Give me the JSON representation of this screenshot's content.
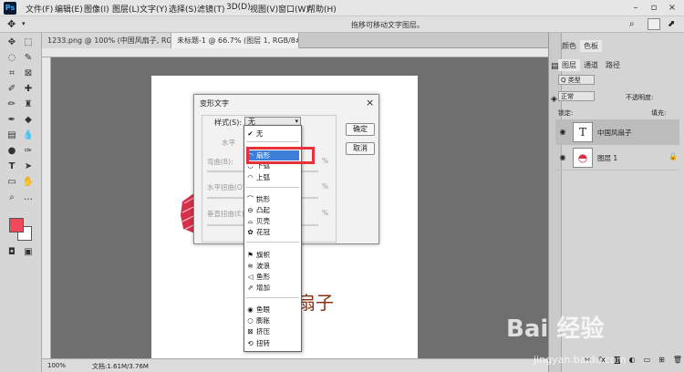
{
  "menubar": {
    "logo": "Ps",
    "items": [
      "文件(F)",
      "编辑(E)",
      "图像(I)",
      "图层(L)",
      "文字(Y)",
      "选择(S)",
      "滤镜(T)",
      "3D(D)",
      "视图(V)",
      "窗口(W)",
      "帮助(H)"
    ]
  },
  "optionsbar": {
    "hint": "拖移可移动文字图层。"
  },
  "tabs": [
    {
      "label": "1233.png @ 100% (中国风扇子, RGB/8) *",
      "close": "×"
    },
    {
      "label": "未标题-1 @ 66.7% (图层 1, RGB/8#) *",
      "close": "×"
    }
  ],
  "status": {
    "zoom": "100%",
    "doc": "文档:1.61M/3.76M"
  },
  "canvas_text": "扇子",
  "panels": {
    "top_tabs": [
      "颜色",
      "色板"
    ],
    "layer_tabs": [
      "图层",
      "通道",
      "路径"
    ],
    "kind": "Q 类型",
    "blend": "正常",
    "opacity_label": "不透明度:",
    "lock_label": "锁定:",
    "fill_label": "填充:",
    "layers": [
      {
        "name": "中国风扇子",
        "type": "text"
      },
      {
        "name": "图层 1",
        "type": "image"
      }
    ]
  },
  "dialog": {
    "title": "变形文字",
    "style_label": "样式(S):",
    "style_value": "无",
    "ok": "确定",
    "cancel": "取消",
    "horizontal_partial": "水平",
    "bend_label": "弯曲(B):",
    "hdist_label": "水平扭曲(O):",
    "vdist_label": "垂直扭曲(E):",
    "percent": "%"
  },
  "dropdown": {
    "items": [
      {
        "icon": "✔",
        "label": "无"
      },
      {
        "icon": "◠",
        "label": "扇形",
        "selected": true
      },
      {
        "icon": "◡",
        "label": "下弧"
      },
      {
        "icon": "◠",
        "label": "上弧"
      },
      {
        "icon": "⌒",
        "label": "拱形"
      },
      {
        "icon": "⊖",
        "label": "凸起"
      },
      {
        "icon": "⌓",
        "label": "贝壳"
      },
      {
        "icon": "✿",
        "label": "花冠"
      },
      {
        "icon": "⚑",
        "label": "旗帜"
      },
      {
        "icon": "≋",
        "label": "波浪"
      },
      {
        "icon": "◁",
        "label": "鱼形"
      },
      {
        "icon": "⇗",
        "label": "增加"
      },
      {
        "icon": "◉",
        "label": "鱼眼"
      },
      {
        "icon": "○",
        "label": "膨胀"
      },
      {
        "icon": "⊠",
        "label": "挤压"
      },
      {
        "icon": "⟲",
        "label": "扭转"
      }
    ]
  },
  "watermark": {
    "brand": "Bai 经验",
    "url": "jingyan.baidu.com"
  },
  "colors": {
    "highlight": "#e6303a",
    "selected": "#3d7fd8",
    "foreground": "#f04a5a"
  }
}
